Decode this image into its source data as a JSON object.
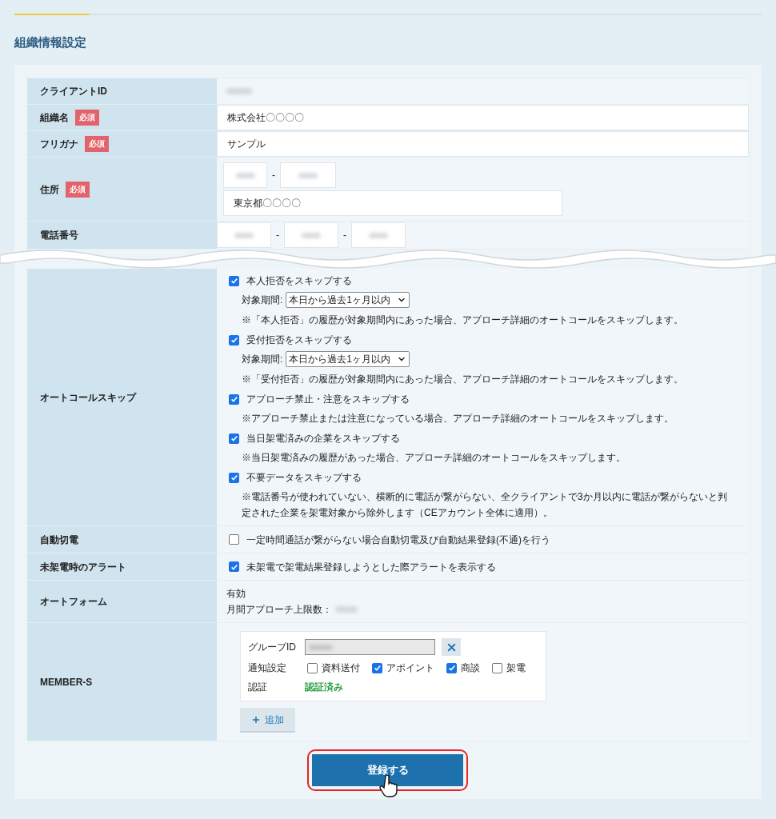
{
  "page_title": "組織情報設定",
  "rows": [
    {
      "kind": "blurred",
      "label": "クライアントID"
    },
    {
      "kind": "text",
      "label": "組織名",
      "badge": "必須",
      "value": "株式会社〇〇〇〇"
    },
    {
      "kind": "text",
      "label": "フリガナ",
      "badge": "必須",
      "value": "サンプル"
    },
    {
      "kind": "address",
      "label": "住所",
      "badge": "必須",
      "separator": "-",
      "value": "東京都〇〇〇〇"
    },
    {
      "kind": "phone",
      "label": "電話番号",
      "separators": [
        "-",
        "-"
      ]
    },
    {
      "kind": "break"
    },
    {
      "kind": "skip",
      "label": "オートコールスキップ",
      "options": [
        {
          "label": "本人拒否をスキップする",
          "checked": true,
          "period_label": "対象期間:",
          "period_value": "本日から過去1ヶ月以内",
          "note": "※「本人拒否」の履歴が対象期間内にあった場合、アプローチ詳細のオートコールをスキップします。"
        },
        {
          "label": "受付拒否をスキップする",
          "checked": true,
          "period_label": "対象期間:",
          "period_value": "本日から過去1ヶ月以内",
          "note": "※「受付拒否」の履歴が対象期間内にあった場合、アプローチ詳細のオートコールをスキップします。"
        },
        {
          "label": "アプローチ禁止・注意をスキップする",
          "checked": true,
          "note": "※アプローチ禁止または注意になっている場合、アプローチ詳細のオートコールをスキップします。"
        },
        {
          "label": "当日架電済みの企業をスキップする",
          "checked": true,
          "note": "※当日架電済みの履歴があった場合、アプローチ詳細のオートコールをスキップします。"
        },
        {
          "label": "不要データをスキップする",
          "checked": true,
          "note": "※電話番号が使われていない、横断的に電話が繋がらない、全クライアントで3か月以内に電話が繋がらないと判定された企業を架電対象から除外します（CEアカウント全体に適用）。"
        }
      ]
    },
    {
      "kind": "checkbox",
      "label": "自動切電",
      "checked": false,
      "text": "一定時間通話が繋がらない場合自動切電及び自動結果登録(不通)を行う"
    },
    {
      "kind": "checkbox",
      "label": "未架電時のアラート",
      "checked": true,
      "text": "未架電で架電結果登録しようとした際アラートを表示する"
    },
    {
      "kind": "autoform",
      "label": "オートフォーム",
      "status": "有効",
      "limit_label": "月間アプローチ上限数："
    },
    {
      "kind": "member",
      "label": "MEMBER-S",
      "group_label": "グループID",
      "notify_label": "通知設定",
      "notify": [
        {
          "label": "資料送付",
          "checked": false
        },
        {
          "label": "アポイント",
          "checked": true
        },
        {
          "label": "商談",
          "checked": true
        },
        {
          "label": "架電",
          "checked": false
        }
      ],
      "auth_label": "認証",
      "auth_value": "認証済み",
      "add_button": "追加"
    }
  ],
  "submit": {
    "label": "登録する",
    "highlighted": true
  }
}
